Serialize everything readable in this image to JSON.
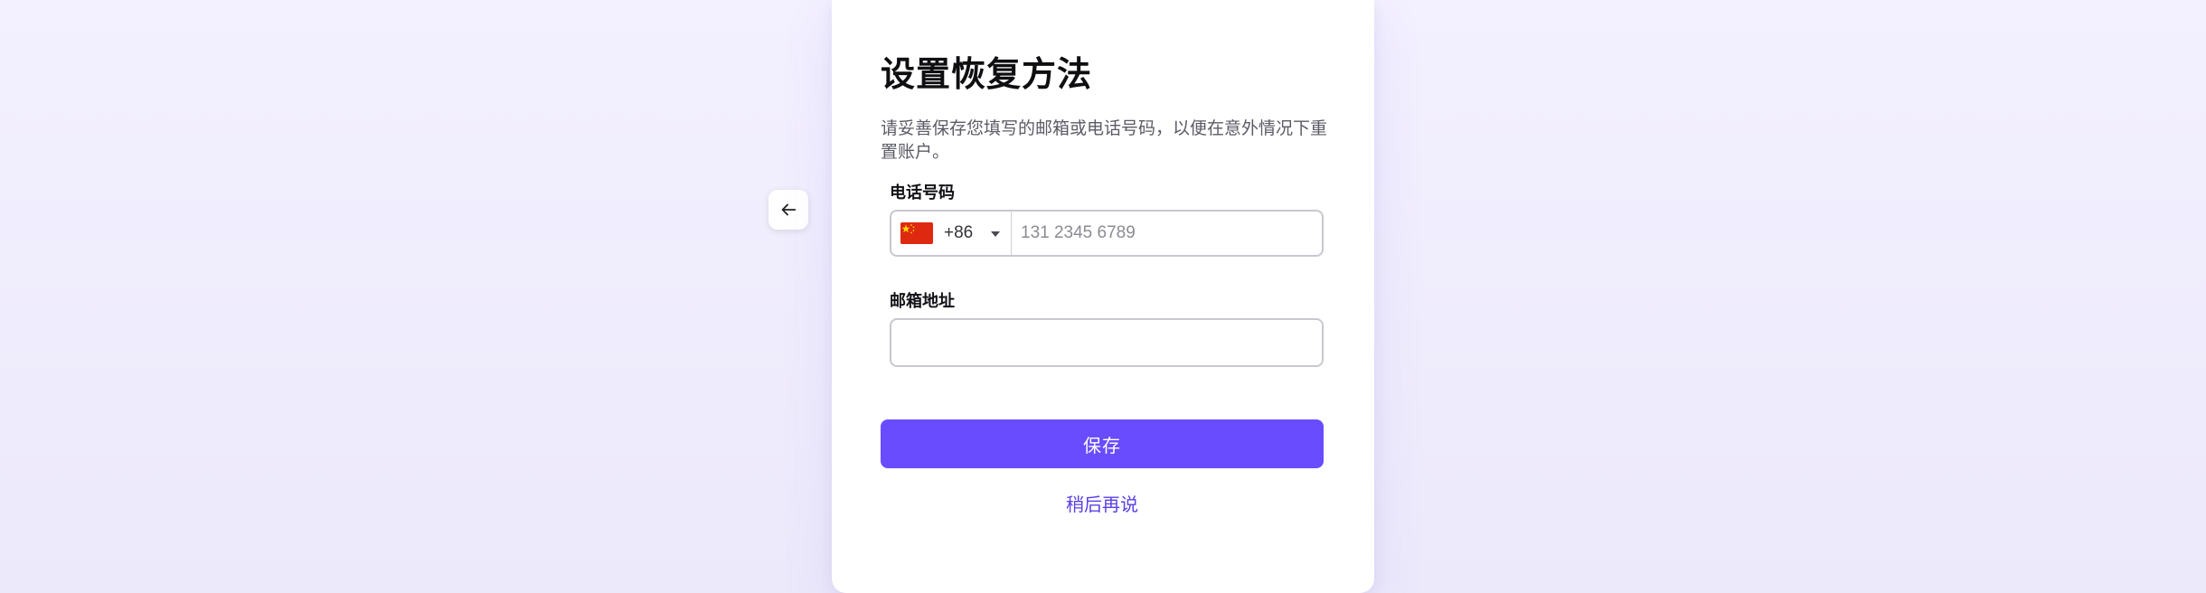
{
  "back_button": {
    "icon": "arrow-left-icon"
  },
  "title": "设置恢复方法",
  "subtitle": "请妥善保存您填写的邮箱或电话号码，以便在意外情况下重置账户。",
  "phone": {
    "label": "电话号码",
    "country_flag": "china-flag-icon",
    "country_code": "+86",
    "placeholder": "131 2345 6789",
    "value": ""
  },
  "email": {
    "label": "邮箱地址",
    "placeholder": "",
    "value": ""
  },
  "save_button": {
    "label": "保存"
  },
  "later_link": {
    "label": "稍后再说"
  },
  "colors": {
    "accent": "#6a4cff",
    "link": "#5b3fe6",
    "flag_red": "#de2910",
    "flag_yellow": "#ffde00"
  }
}
